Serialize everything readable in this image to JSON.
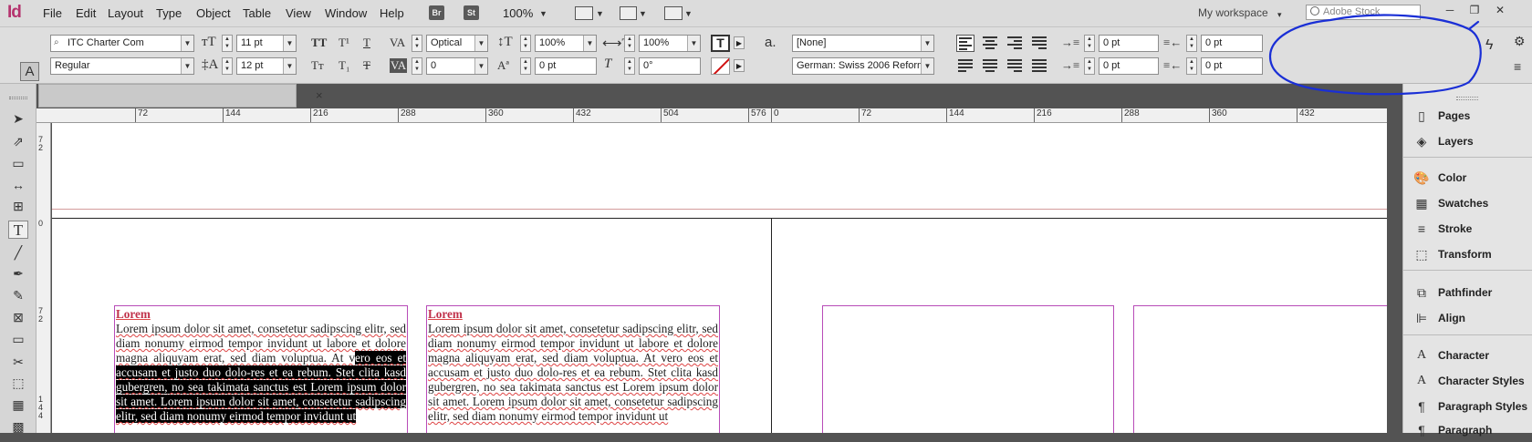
{
  "app": {
    "logo": "Id"
  },
  "menu": [
    "File",
    "Edit",
    "Layout",
    "Type",
    "Object",
    "Table",
    "View",
    "Window",
    "Help"
  ],
  "badges": [
    "Br",
    "St"
  ],
  "zoom": "100%",
  "workspace": "My workspace",
  "stock_search": {
    "placeholder": "Adobe Stock"
  },
  "control_panel": {
    "font_family": "ITC Charter Com",
    "font_style": "Regular",
    "font_size": "11 pt",
    "leading": "12 pt",
    "kerning": "Optical",
    "tracking": "0",
    "vertical_scale": "100%",
    "horizontal_scale": "100%",
    "baseline_shift": "0 pt",
    "skew": "0°",
    "char_style": "[None]",
    "language": "German: Swiss 2006 Reform",
    "left_indent": "0 pt",
    "right_indent": "0 pt",
    "first_line_indent": "0 pt",
    "last_line_indent": "0 pt"
  },
  "document_tab": {
    "close": "×"
  },
  "ruler": {
    "left_page": [
      "72",
      "144",
      "216",
      "288",
      "360",
      "432",
      "504",
      "576"
    ],
    "right_page": [
      "0",
      "72",
      "144",
      "216",
      "288",
      "360",
      "432"
    ],
    "vertical": [
      "7\n2",
      "0",
      "7\n2",
      "1\n4\n4"
    ]
  },
  "text_frames": [
    {
      "heading": "Lorem",
      "lines_before": "Lorem ipsum dolor sit amet, consetetur sadipscing elitr, sed diam nonumy eirmod tempor invidunt ut labore et dolore magna aliquyam erat, sed diam voluptua. At v",
      "highlight": "ero eos et accusam et justo duo dolo-res et ea rebum. Stet clita kasd gubergren, no sea takimata sanctus est Lorem ipsum dolor sit amet. Lorem ipsum dolor sit amet, consetetur sadipscing elitr, sed diam nonumy eirmod tempor invidunt ut",
      "lines_after": ""
    },
    {
      "heading": "Lorem",
      "lines_before": "Lorem ipsum dolor sit amet, consetetur sadipscing elitr, sed diam nonumy eirmod tempor invidunt ut labore et dolore magna aliquyam erat, sed diam voluptua. At vero eos et accusam et justo duo dolo-res et ea rebum. Stet clita kasd gubergren, no sea takimata sanctus est Lorem ipsum dolor sit amet. Lorem ipsum dolor sit amet, consetetur sadipscing elitr, sed diam nonumy eirmod tempor invidunt ut",
      "highlight": "",
      "lines_after": ""
    }
  ],
  "panels": [
    {
      "label": "Pages",
      "icon": "pages-icon"
    },
    {
      "label": "Layers",
      "icon": "layers-icon"
    },
    {
      "label": "Color",
      "icon": "color-icon"
    },
    {
      "label": "Swatches",
      "icon": "swatches-icon"
    },
    {
      "label": "Stroke",
      "icon": "stroke-icon"
    },
    {
      "label": "Transform",
      "icon": "transform-icon"
    },
    {
      "label": "Pathfinder",
      "icon": "pathfinder-icon"
    },
    {
      "label": "Align",
      "icon": "align-icon"
    },
    {
      "label": "Character",
      "icon": "character-icon"
    },
    {
      "label": "Character Styles",
      "icon": "character-styles-icon"
    },
    {
      "label": "Paragraph Styles",
      "icon": "paragraph-styles-icon"
    },
    {
      "label": "Paragraph",
      "icon": "paragraph-icon"
    }
  ],
  "colors": {
    "accent": "#b5336e",
    "frame": "#b84cb8",
    "annotation": "#1a2fd6"
  }
}
